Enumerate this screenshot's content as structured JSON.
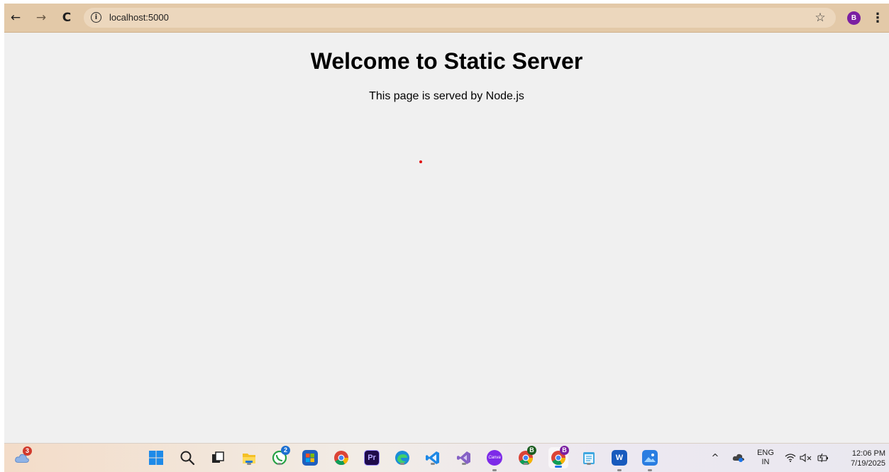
{
  "browser": {
    "url": "localhost:5000",
    "back_icon": "←",
    "forward_icon": "→",
    "reload_icon": "C",
    "info_icon": "i",
    "star_icon": "☆",
    "profile_initial": "B",
    "menu_icon": "⋮"
  },
  "page": {
    "heading": "Welcome to Static Server",
    "subtext": "This page is served by Node.js"
  },
  "taskbar": {
    "weather_badge": "3",
    "whatsapp_badge": "2",
    "premiere_label": "Pr",
    "canva_label": "Canva",
    "word_label": "W",
    "chrome_profile1_badge": "B",
    "chrome_profile2_badge": "B",
    "tray": {
      "chevron": "^",
      "language": "ENG",
      "region": "IN",
      "time": "12:06 PM",
      "date": "7/19/2025"
    }
  }
}
